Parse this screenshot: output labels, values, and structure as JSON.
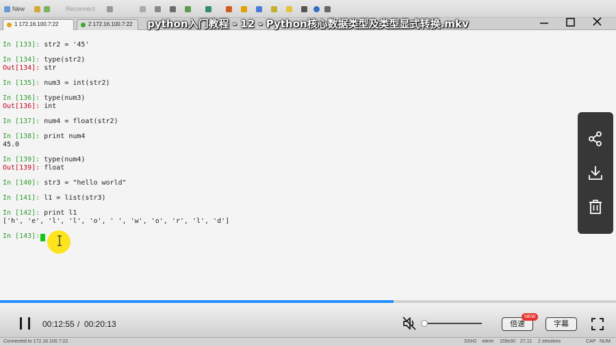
{
  "player": {
    "title": "python入门教程 - 12 - Python核心数据类型及类型显式转换.mkv",
    "current_time": "00:12:55",
    "separator": "/",
    "total_time": "00:20:13",
    "progress_fraction": 0.639,
    "volume_fraction": 0.0,
    "speed_label": "倍速",
    "new_badge": "NEW",
    "subtitle_label": "字幕",
    "accent_color": "#1f8fff"
  },
  "terminal_chrome": {
    "new_label": "New",
    "reconnect_label": "Reconnect",
    "tabs": [
      {
        "label": "1 172.16.100.7:22"
      },
      {
        "label": "2 172.16.100.7:22"
      }
    ]
  },
  "terminal": {
    "lines": [
      {
        "in_num": "133",
        "in": "str2 = '45'"
      },
      {
        "in_num": "134",
        "in": "type(str2)",
        "out_num": "134",
        "out": "str"
      },
      {
        "in_num": "135",
        "in": "num3 = int(str2)"
      },
      {
        "in_num": "136",
        "in": "type(num3)",
        "out_num": "136",
        "out": "int"
      },
      {
        "in_num": "137",
        "in": "num4 = float(str2)"
      },
      {
        "in_num": "138",
        "in": "print num4",
        "plain_out": "45.0"
      },
      {
        "in_num": "139",
        "in": "type(num4)",
        "out_num": "139",
        "out": "float"
      },
      {
        "in_num": "140",
        "in": "str3 = \"hello world\""
      },
      {
        "in_num": "141",
        "in": "l1 = list(str3)"
      },
      {
        "in_num": "142",
        "in": "print l1",
        "plain_out": "['h', 'e', 'l', 'l', 'o', ' ', 'w', 'o', 'r', 'l', 'd']"
      },
      {
        "in_num": "143",
        "in": ""
      }
    ]
  },
  "status_bar": {
    "connected": "Connected to 172.16.100.7:22.",
    "protocol": "SSH2",
    "term": "xterm",
    "size": "159x30",
    "position": "27,11",
    "sessions": "2 sessions",
    "caps": "CAP",
    "num": "NUM"
  },
  "icons": {
    "share": "share-icon",
    "download": "download-icon",
    "delete": "trash-icon",
    "pause": "pause-icon",
    "mute": "muted-speaker-icon",
    "fullscreen": "fullscreen-icon",
    "minimize": "minimize-icon",
    "maximize": "maximize-icon",
    "close": "close-icon"
  }
}
